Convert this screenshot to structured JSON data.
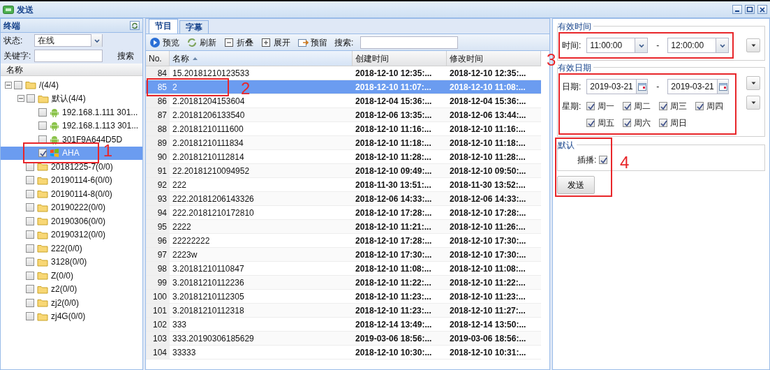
{
  "window": {
    "title": "发送"
  },
  "terminal_panel": {
    "title": "终端",
    "status_label": "状态:",
    "status_value": "在线",
    "keyword_label": "关键字:",
    "search_button": "搜索",
    "column": "名称",
    "tree": [
      {
        "label": "/(4/4)",
        "kind": "folder",
        "checked": false,
        "expanded": true,
        "selected": false,
        "children": [
          {
            "label": "默认(4/4)",
            "kind": "folder",
            "checked": false,
            "expanded": true,
            "selected": false,
            "children": [
              {
                "label": "192.168.1.111 301...",
                "kind": "android",
                "checked": false,
                "selected": false
              },
              {
                "label": "192.168.1.113 301...",
                "kind": "android",
                "checked": false,
                "selected": false
              },
              {
                "label": "301F9A644D5D",
                "kind": "android",
                "checked": false,
                "selected": false
              },
              {
                "label": "AHA",
                "kind": "windows",
                "checked": true,
                "selected": true
              }
            ]
          },
          {
            "label": "20181225-7(0/0)",
            "kind": "folder",
            "checked": false,
            "selected": false
          },
          {
            "label": "20190114-6(0/0)",
            "kind": "folder",
            "checked": false,
            "selected": false
          },
          {
            "label": "20190114-8(0/0)",
            "kind": "folder",
            "checked": false,
            "selected": false
          },
          {
            "label": "20190222(0/0)",
            "kind": "folder",
            "checked": false,
            "selected": false
          },
          {
            "label": "20190306(0/0)",
            "kind": "folder",
            "checked": false,
            "selected": false
          },
          {
            "label": "20190312(0/0)",
            "kind": "folder",
            "checked": false,
            "selected": false
          },
          {
            "label": "222(0/0)",
            "kind": "folder",
            "checked": false,
            "selected": false
          },
          {
            "label": "3128(0/0)",
            "kind": "folder",
            "checked": false,
            "selected": false
          },
          {
            "label": "Z(0/0)",
            "kind": "folder",
            "checked": false,
            "selected": false
          },
          {
            "label": "z2(0/0)",
            "kind": "folder",
            "checked": false,
            "selected": false
          },
          {
            "label": "zj2(0/0)",
            "kind": "folder",
            "checked": false,
            "selected": false
          },
          {
            "label": "zj4G(0/0)",
            "kind": "folder",
            "checked": false,
            "selected": false
          }
        ]
      }
    ]
  },
  "tabs": [
    {
      "label": "节目",
      "selected": true
    },
    {
      "label": "字幕",
      "selected": false
    }
  ],
  "toolbar": [
    {
      "label": "预览",
      "kind": "play"
    },
    {
      "label": "刷新",
      "kind": "refresh"
    },
    {
      "label": "折叠",
      "kind": "collapse"
    },
    {
      "label": "展开",
      "kind": "expand"
    },
    {
      "label": "预留",
      "kind": "reserve"
    }
  ],
  "search_label": "搜索:",
  "table": {
    "columns": [
      {
        "label": "No.",
        "sorted": false
      },
      {
        "label": "名称",
        "sorted": true
      },
      {
        "label": "创建时间",
        "sorted": false
      },
      {
        "label": "修改时间",
        "sorted": false
      }
    ],
    "rows": [
      {
        "no": "84",
        "name": "15.20181210123533",
        "created": "2018-12-10 12:35:...",
        "modified": "2018-12-10 12:35:...",
        "selected": false
      },
      {
        "no": "85",
        "name": "2",
        "created": "2018-12-10 11:07:...",
        "modified": "2018-12-10 11:08:...",
        "selected": true
      },
      {
        "no": "86",
        "name": "2.20181204153604",
        "created": "2018-12-04 15:36:...",
        "modified": "2018-12-04 15:36:...",
        "selected": false
      },
      {
        "no": "87",
        "name": "2.20181206133540",
        "created": "2018-12-06 13:35:...",
        "modified": "2018-12-06 13:44:...",
        "selected": false
      },
      {
        "no": "88",
        "name": "2.20181210111600",
        "created": "2018-12-10 11:16:...",
        "modified": "2018-12-10 11:16:...",
        "selected": false
      },
      {
        "no": "89",
        "name": "2.20181210111834",
        "created": "2018-12-10 11:18:...",
        "modified": "2018-12-10 11:18:...",
        "selected": false
      },
      {
        "no": "90",
        "name": "2.20181210112814",
        "created": "2018-12-10 11:28:...",
        "modified": "2018-12-10 11:28:...",
        "selected": false
      },
      {
        "no": "91",
        "name": "22.20181210094952",
        "created": "2018-12-10 09:49:...",
        "modified": "2018-12-10 09:50:...",
        "selected": false
      },
      {
        "no": "92",
        "name": "222",
        "created": "2018-11-30 13:51:...",
        "modified": "2018-11-30 13:52:...",
        "selected": false
      },
      {
        "no": "93",
        "name": "222.20181206143326",
        "created": "2018-12-06 14:33:...",
        "modified": "2018-12-06 14:33:...",
        "selected": false
      },
      {
        "no": "94",
        "name": "222.20181210172810",
        "created": "2018-12-10 17:28:...",
        "modified": "2018-12-10 17:28:...",
        "selected": false
      },
      {
        "no": "95",
        "name": "2222",
        "created": "2018-12-10 11:21:...",
        "modified": "2018-12-10 11:26:...",
        "selected": false
      },
      {
        "no": "96",
        "name": "22222222",
        "created": "2018-12-10 17:28:...",
        "modified": "2018-12-10 17:30:...",
        "selected": false
      },
      {
        "no": "97",
        "name": "2223w",
        "created": "2018-12-10 17:30:...",
        "modified": "2018-12-10 17:30:...",
        "selected": false
      },
      {
        "no": "98",
        "name": "3.20181210110847",
        "created": "2018-12-10 11:08:...",
        "modified": "2018-12-10 11:08:...",
        "selected": false
      },
      {
        "no": "99",
        "name": "3.20181210112236",
        "created": "2018-12-10 11:22:...",
        "modified": "2018-12-10 11:22:...",
        "selected": false
      },
      {
        "no": "100",
        "name": "3.20181210112305",
        "created": "2018-12-10 11:23:...",
        "modified": "2018-12-10 11:23:...",
        "selected": false
      },
      {
        "no": "101",
        "name": "3.20181210112318",
        "created": "2018-12-10 11:23:...",
        "modified": "2018-12-10 11:27:...",
        "selected": false
      },
      {
        "no": "102",
        "name": "333",
        "created": "2018-12-14 13:49:...",
        "modified": "2018-12-14 13:50:...",
        "selected": false
      },
      {
        "no": "103",
        "name": "333.20190306185629",
        "created": "2019-03-06 18:56:...",
        "modified": "2019-03-06 18:56:...",
        "selected": false
      },
      {
        "no": "104",
        "name": "33333",
        "created": "2018-12-10 10:30:...",
        "modified": "2018-12-10 10:31:...",
        "selected": false
      }
    ]
  },
  "settings": {
    "time": {
      "legend": "有效时间",
      "label": "时间:",
      "from": "11:00:00",
      "separator": "-",
      "to": "12:00:00"
    },
    "date": {
      "legend": "有效日期",
      "label": "日期:",
      "from": "2019-03-21",
      "separator": "-",
      "to": "2019-03-21",
      "weekday_label": "星期:",
      "weekdays": [
        {
          "label": "周一",
          "checked": true
        },
        {
          "label": "周二",
          "checked": true
        },
        {
          "label": "周三",
          "checked": true
        },
        {
          "label": "周四",
          "checked": true
        },
        {
          "label": "周五",
          "checked": true
        },
        {
          "label": "周六",
          "checked": true
        },
        {
          "label": "周日",
          "checked": true
        }
      ]
    },
    "default": {
      "legend": "默认",
      "insert_label": "插播:",
      "insert_checked": true
    },
    "send_button": "发送"
  },
  "annotations": [
    {
      "label": "1"
    },
    {
      "label": "2"
    },
    {
      "label": "3"
    },
    {
      "label": "4"
    }
  ]
}
